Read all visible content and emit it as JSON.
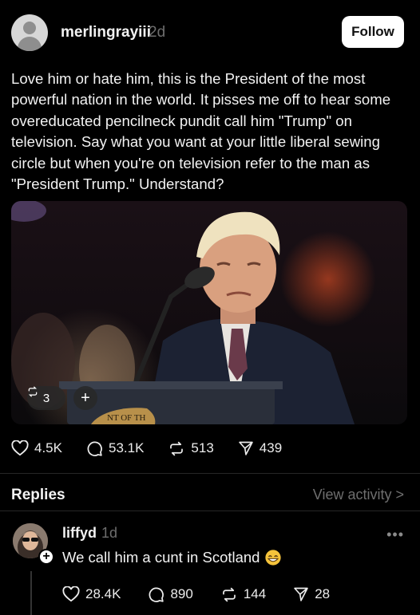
{
  "post": {
    "username": "merlingrayiii",
    "time": "2d",
    "follow_label": "Follow",
    "text": "Love him or hate him, this is the President of the most powerful nation in the world. It pisses me off to hear some overeducated pencilneck pundit call him \"Trump\" on television.  Say what you want at your little liberal sewing circle but when you're on television refer to the man as \"President Trump.\" Understand?",
    "photo": {
      "podium_seal_text": "NT OF TH",
      "repost_count": "3",
      "add_label": "+"
    },
    "actions": {
      "likes": "4.5K",
      "comments": "53.1K",
      "reposts": "513",
      "shares": "439"
    }
  },
  "replies_section": {
    "title": "Replies",
    "view_activity": "View activity >"
  },
  "reply": {
    "username": "liffyd",
    "time": "1d",
    "text": "We call him a cunt in Scotland",
    "more_label": "•••",
    "add_label": "+",
    "actions": {
      "likes": "28.4K",
      "comments": "890",
      "reposts": "144",
      "shares": "28"
    }
  },
  "icons": {
    "like": "heart-icon",
    "comment": "comment-bubble-icon",
    "repost": "repost-icon",
    "share": "send-icon",
    "emoji": "grinning-emoji-icon"
  },
  "colors": {
    "background": "#000000",
    "text": "#f2f2f2",
    "muted": "#6e6e6e",
    "follow_bg": "#ffffff"
  }
}
